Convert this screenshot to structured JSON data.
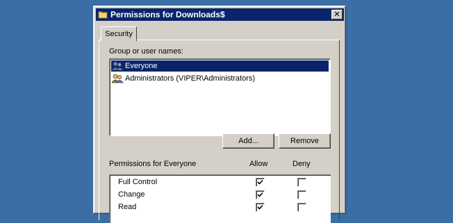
{
  "window": {
    "title": "Permissions for Downloads$",
    "title_icon": "folder-icon",
    "close_label": "✕"
  },
  "tabs": [
    {
      "label": "Security",
      "active": true
    }
  ],
  "group_label": "Group or user names:",
  "users": [
    {
      "name": "Everyone",
      "icon": "users-group-icon",
      "selected": true
    },
    {
      "name": "Administrators (VIPER\\Administrators)",
      "icon": "admin-group-icon",
      "selected": false
    }
  ],
  "buttons": {
    "add_label": "Add...",
    "remove_label": "Remove"
  },
  "permissions": {
    "header_label": "Permissions for Everyone",
    "allow_label": "Allow",
    "deny_label": "Deny",
    "rows": [
      {
        "name": "Full Control",
        "allow": true,
        "deny": false
      },
      {
        "name": "Change",
        "allow": true,
        "deny": false
      },
      {
        "name": "Read",
        "allow": true,
        "deny": false
      }
    ]
  },
  "colors": {
    "desktop": "#3a6ea5",
    "titlebar": "#0a246a",
    "selection": "#0a246a",
    "face": "#d4d0c8"
  }
}
